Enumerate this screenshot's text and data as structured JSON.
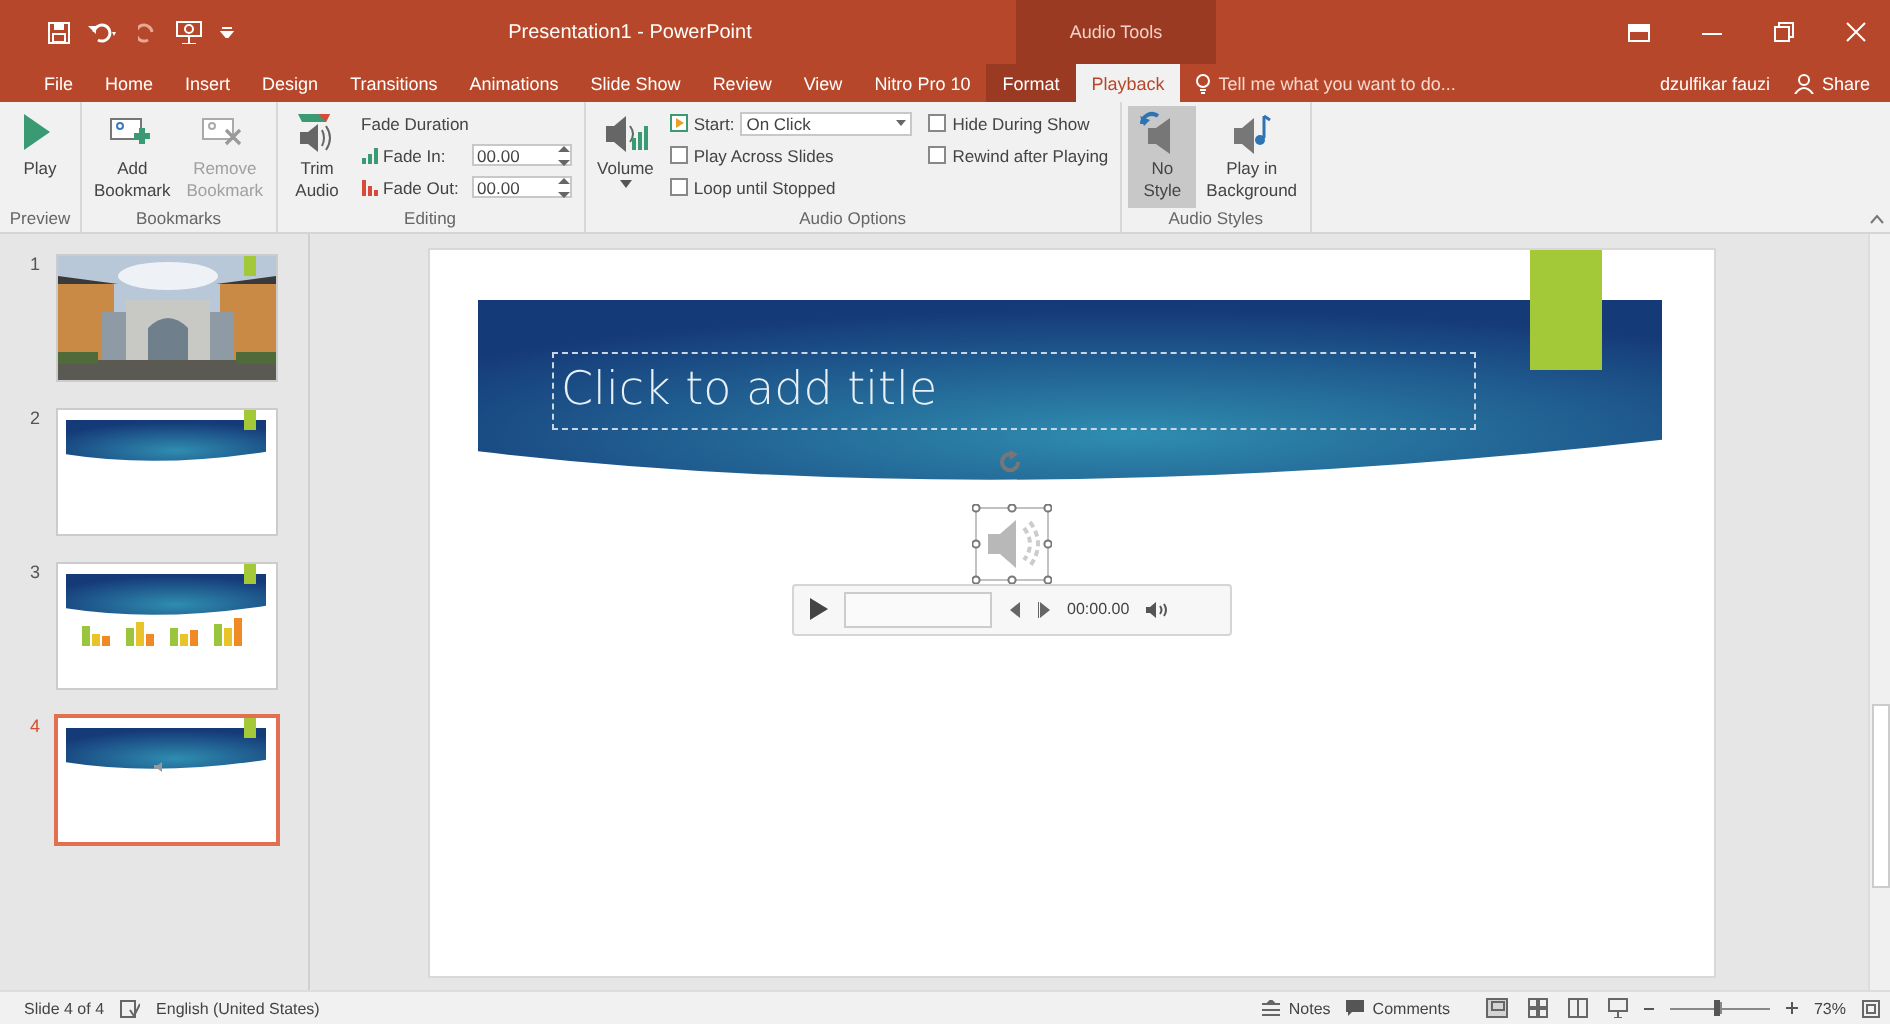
{
  "window": {
    "title": "Presentation1 - PowerPoint",
    "context_group": "Audio Tools",
    "user": "dzulfikar fauzi",
    "share": "Share"
  },
  "tabs": [
    {
      "label": "File",
      "selected": false
    },
    {
      "label": "Home",
      "selected": false
    },
    {
      "label": "Insert",
      "selected": false
    },
    {
      "label": "Design",
      "selected": false
    },
    {
      "label": "Transitions",
      "selected": false
    },
    {
      "label": "Animations",
      "selected": false
    },
    {
      "label": "Slide Show",
      "selected": false
    },
    {
      "label": "Review",
      "selected": false
    },
    {
      "label": "View",
      "selected": false
    },
    {
      "label": "Nitro Pro 10",
      "selected": false
    },
    {
      "label": "Format",
      "selected": false
    },
    {
      "label": "Playback",
      "selected": true
    }
  ],
  "tell_me": {
    "placeholder": "Tell me what you want to do..."
  },
  "ribbon": {
    "groups": [
      {
        "label": "Preview",
        "items": [
          {
            "kind": "big_button",
            "label": "Play",
            "disabled": false
          }
        ]
      },
      {
        "label": "Bookmarks",
        "items": [
          {
            "kind": "big_button",
            "label": "Add\nBookmark",
            "disabled": false
          },
          {
            "kind": "big_button",
            "label": "Remove\nBookmark",
            "disabled": true
          }
        ]
      },
      {
        "label": "Editing",
        "items": [
          {
            "kind": "big_button",
            "label": "Trim\nAudio",
            "disabled": false
          },
          {
            "kind": "stack",
            "items": [
              {
                "kind": "heading",
                "label": "Fade Duration"
              },
              {
                "kind": "spinner",
                "label": "Fade In:",
                "value": "00.00"
              },
              {
                "kind": "spinner",
                "label": "Fade Out:",
                "value": "00.00"
              }
            ]
          }
        ]
      },
      {
        "label": "Audio Options",
        "items": [
          {
            "kind": "big_button",
            "label": "Volume",
            "disabled": false,
            "dropdown": true
          },
          {
            "kind": "stack",
            "items": [
              {
                "kind": "dropdown",
                "label": "Start:",
                "value": "On Click"
              },
              {
                "kind": "checkbox",
                "label": "Play Across Slides",
                "checked": false
              },
              {
                "kind": "checkbox",
                "label": "Loop until Stopped",
                "checked": false
              }
            ]
          },
          {
            "kind": "stack",
            "items": [
              {
                "kind": "checkbox",
                "label": "Hide During Show",
                "checked": false
              },
              {
                "kind": "checkbox",
                "label": "Rewind after Playing",
                "checked": false
              }
            ]
          }
        ]
      },
      {
        "label": "Audio Styles",
        "items": [
          {
            "kind": "big_button",
            "label": "No\nStyle",
            "disabled": false,
            "selected": true
          },
          {
            "kind": "big_button",
            "label": "Play in\nBackground",
            "disabled": false,
            "selected": false
          }
        ]
      }
    ]
  },
  "slides": [
    {
      "number": "1",
      "selected": false
    },
    {
      "number": "2",
      "kind": "title",
      "selected": false
    },
    {
      "number": "3",
      "kind": "chart",
      "selected": false
    },
    {
      "number": "4",
      "kind": "audio",
      "selected": true
    }
  ],
  "slide": {
    "title_placeholder": "Click to add title",
    "player_time": "00:00.00"
  },
  "status_bar": {
    "slide_info": "Slide 4 of 4",
    "language": "English (United States)",
    "notes": "Notes",
    "comments": "Comments",
    "zoom": "73%",
    "zoom_slider": {
      "level": 0.47
    }
  }
}
